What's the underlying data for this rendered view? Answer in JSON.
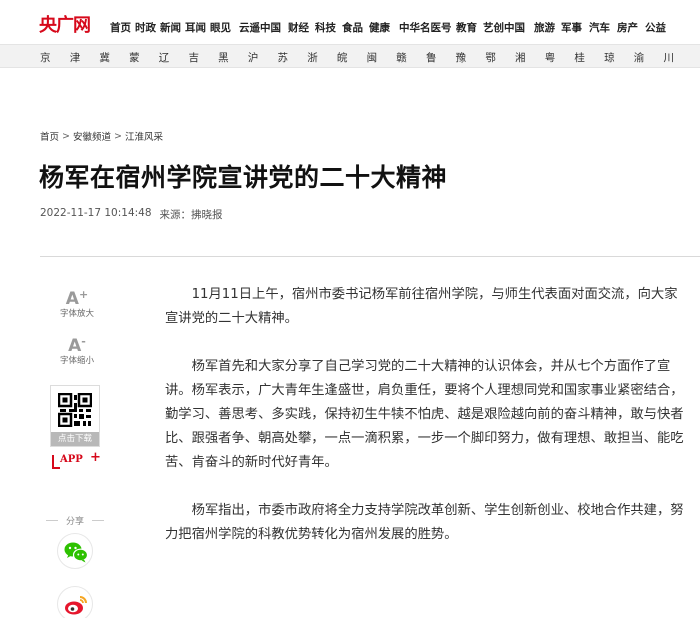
{
  "header": {
    "logo": "央广网",
    "nav": [
      "首页",
      "时政",
      "新闻",
      "耳闻",
      "眼见",
      "云遥中国",
      "财经",
      "科技",
      "食品",
      "健康",
      "中华名医号",
      "教育",
      "艺创中国",
      "旅游",
      "军事",
      "汽车",
      "房产",
      "公益"
    ],
    "provinces": [
      "京",
      "津",
      "冀",
      "蒙",
      "辽",
      "吉",
      "黑",
      "沪",
      "苏",
      "浙",
      "皖",
      "闽",
      "赣",
      "鲁",
      "豫",
      "鄂",
      "湘",
      "粤",
      "桂",
      "琼",
      "渝",
      "川"
    ]
  },
  "breadcrumb": [
    "首页",
    "安徽频道",
    "江淮风采"
  ],
  "article": {
    "title": "杨军在宿州学院宣讲党的二十大精神",
    "datetime": "2022-11-17 10:14:48",
    "source": "来源：拂晓报",
    "paragraphs": [
      "11月11日上午，宿州市委书记杨军前往宿州学院，与师生代表面对面交流，向大家宣讲党的二十大精神。",
      "杨军首先和大家分享了自己学习党的二十大精神的认识体会，并从七个方面作了宣讲。杨军表示，广大青年生逢盛世，肩负重任，要将个人理想同党和国家事业紧密结合，勤学习、善思考、多实践，保持初生牛犊不怕虎、越是艰险越向前的奋斗精神，敢与快者比、跟强者争、朝高处攀，一点一滴积累，一步一个脚印努力，做有理想、敢担当、能吃苦、肯奋斗的新时代好青年。",
      "杨军指出，市委市政府将全力支持学院改革创新、学生创新创业、校地合作共建，努力把宿州学院的科教优势转化为宿州发展的胜势。"
    ]
  },
  "tools": {
    "font_up_glyph": "A",
    "font_up_mark": "+",
    "font_up_label": "字体放大",
    "font_down_glyph": "A",
    "font_down_mark": "-",
    "font_down_label": "字体缩小",
    "download_label": "点击下载",
    "app_label": "APP",
    "app_plus": "+",
    "share_label": "分享"
  },
  "colors": {
    "brand": "#d6091b",
    "wechat": "#2dc100",
    "weibo": "#e6162d"
  }
}
